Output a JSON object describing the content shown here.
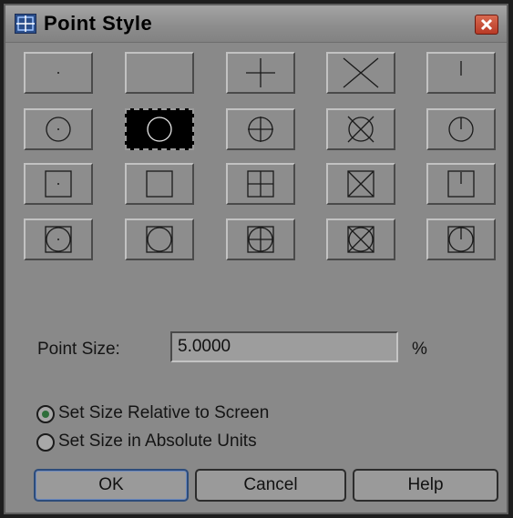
{
  "dialog": {
    "title": "Point Style",
    "app_icon": "point-style-app-icon",
    "close_icon": "close-icon"
  },
  "point_styles": {
    "selected_index": 6,
    "rows": 4,
    "columns": 5,
    "cells": [
      {
        "name": "dot",
        "icon": "point-dot-icon"
      },
      {
        "name": "none",
        "icon": "point-none-icon"
      },
      {
        "name": "plus",
        "icon": "point-plus-icon"
      },
      {
        "name": "x",
        "icon": "point-x-icon"
      },
      {
        "name": "tick",
        "icon": "point-tick-icon"
      },
      {
        "name": "circle-dot",
        "icon": "point-circle-dot-icon"
      },
      {
        "name": "circle",
        "icon": "point-circle-icon"
      },
      {
        "name": "circle-plus",
        "icon": "point-circle-plus-icon"
      },
      {
        "name": "circle-x",
        "icon": "point-circle-x-icon"
      },
      {
        "name": "circle-tick",
        "icon": "point-circle-tick-icon"
      },
      {
        "name": "square-dot",
        "icon": "point-square-dot-icon"
      },
      {
        "name": "square",
        "icon": "point-square-icon"
      },
      {
        "name": "square-plus",
        "icon": "point-square-plus-icon"
      },
      {
        "name": "square-x",
        "icon": "point-square-x-icon"
      },
      {
        "name": "square-tick",
        "icon": "point-square-tick-icon"
      },
      {
        "name": "square-circle-dot",
        "icon": "point-square-circle-dot-icon"
      },
      {
        "name": "square-circle",
        "icon": "point-square-circle-icon"
      },
      {
        "name": "square-circle-plus",
        "icon": "point-square-circle-plus-icon"
      },
      {
        "name": "square-circle-x",
        "icon": "point-square-circle-x-icon"
      },
      {
        "name": "square-circle-tick",
        "icon": "point-square-circle-tick-icon"
      }
    ]
  },
  "point_size": {
    "label": "Point Size:",
    "value": "5.0000",
    "unit": "%"
  },
  "size_mode": {
    "options": [
      {
        "label": "Set Size Relative to Screen",
        "selected": true
      },
      {
        "label": "Set Size in Absolute Units",
        "selected": false
      }
    ]
  },
  "buttons": {
    "ok": "OK",
    "cancel": "Cancel",
    "help": "Help"
  },
  "colors": {
    "dialog_bg": "#898989",
    "selected_radio": "#2e6e3a"
  }
}
